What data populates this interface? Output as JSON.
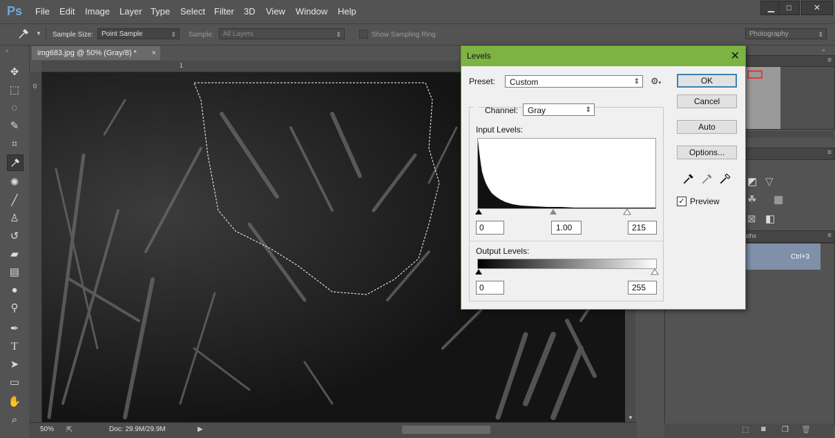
{
  "app": {
    "logo": "Ps",
    "menu": [
      "File",
      "Edit",
      "Image",
      "Layer",
      "Type",
      "Select",
      "Filter",
      "3D",
      "View",
      "Window",
      "Help"
    ],
    "window_controls": {
      "minimize": "▁",
      "maximize": "□",
      "close": "✕"
    }
  },
  "options_bar": {
    "sample_size_label": "Sample Size:",
    "sample_size_value": "Point Sample",
    "sample_label": "Sample:",
    "sample_value": "All Layers",
    "sampling_ring_label": "Show Sampling Ring",
    "workspace_value": "Photography"
  },
  "document": {
    "tab_title": "img683.jpg @ 50% (Gray/8) *",
    "tab_close": "×",
    "ruler_top_mark": "1",
    "ruler_left_mark": "0",
    "zoom": "50%",
    "doc_size": "Doc: 29.9M/29.9M"
  },
  "right_panel": {
    "paths_label": "aths",
    "shortcut": "Ctrl+3"
  },
  "levels_dialog": {
    "title": "Levels",
    "close": "✕",
    "preset_label": "Preset:",
    "preset_value": "Custom",
    "channel_label": "Channel:",
    "channel_value": "Gray",
    "input_levels_label": "Input Levels:",
    "input_black": "0",
    "input_gamma": "1.00",
    "input_white": "215",
    "output_levels_label": "Output Levels:",
    "output_black": "0",
    "output_white": "255",
    "buttons": {
      "ok": "OK",
      "cancel": "Cancel",
      "auto": "Auto",
      "options": "Options..."
    },
    "preview_label": "Preview",
    "preview_checked": true
  },
  "colors": {
    "dialog_title_bar": "#7cb342",
    "ui_background": "#535353",
    "ps_logo": "#6fa8dc",
    "highlight_row": "#7f90a8"
  }
}
